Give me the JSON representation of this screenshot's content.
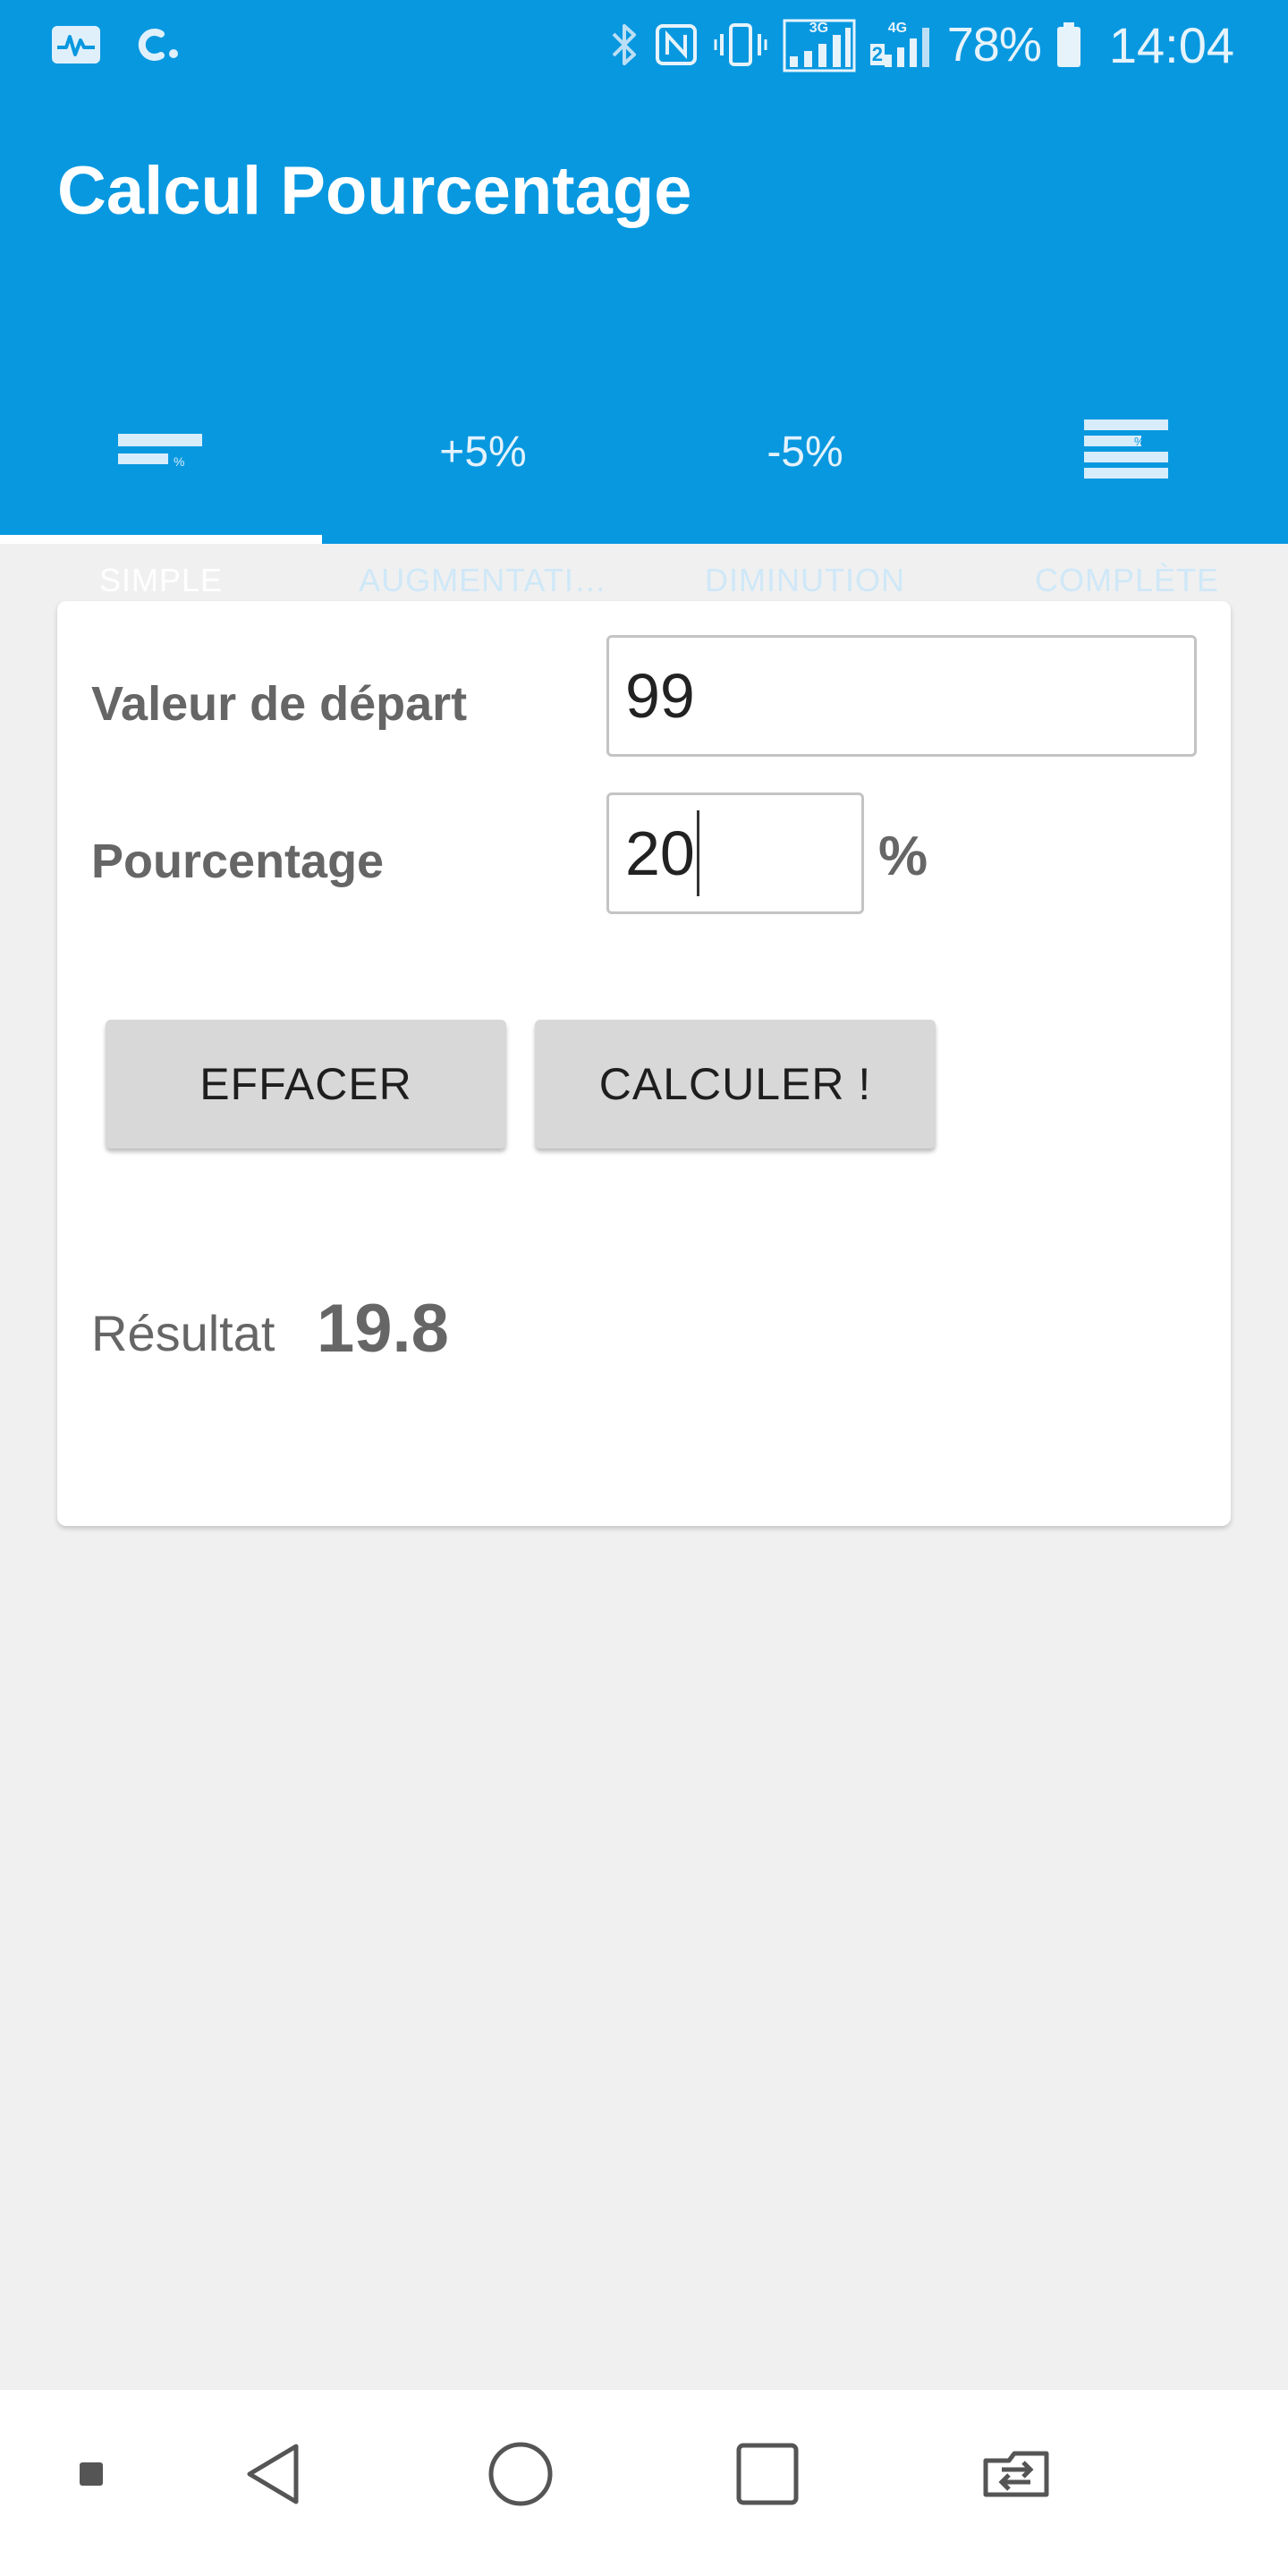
{
  "status_bar": {
    "left_icons": [
      "activity-icon",
      "c-app-icon"
    ],
    "right_icons": [
      "bluetooth-icon",
      "nfc-icon",
      "vibrate-icon",
      "signal-3g-icon",
      "signal-4g-icon",
      "battery-icon"
    ],
    "network_3g": "3G",
    "network_4g": "4G",
    "sim2": "2",
    "battery": "78%",
    "time": "14:04"
  },
  "app_bar": {
    "title": "Calcul Pourcentage"
  },
  "tabs": [
    {
      "label": "SIMPLE",
      "icon": "simple-bar-icon",
      "active": true
    },
    {
      "label": "AUGMENTATI…",
      "icon_text": "+5%",
      "active": false
    },
    {
      "label": "DIMINUTION",
      "icon_text": "-5%",
      "active": false
    },
    {
      "label": "COMPLÈTE",
      "icon": "complete-bars-icon",
      "active": false
    }
  ],
  "form": {
    "start_value_label": "Valeur de départ",
    "start_value": "99",
    "percentage_label": "Pourcentage",
    "percentage_value": "20",
    "percent_sign": "%",
    "clear_button": "EFFACER",
    "calculate_button": "CALCULER !",
    "result_label": "Résultat",
    "result_value": "19.8"
  },
  "nav_bar": {
    "buttons": [
      "notification-dot-icon",
      "back-icon",
      "home-icon",
      "recents-icon",
      "switch-sim-icon"
    ]
  },
  "colors": {
    "primary": "#0898e0",
    "background": "#f0f0f0",
    "card": "#ffffff",
    "button": "#d8d8d8",
    "label": "#666666"
  }
}
